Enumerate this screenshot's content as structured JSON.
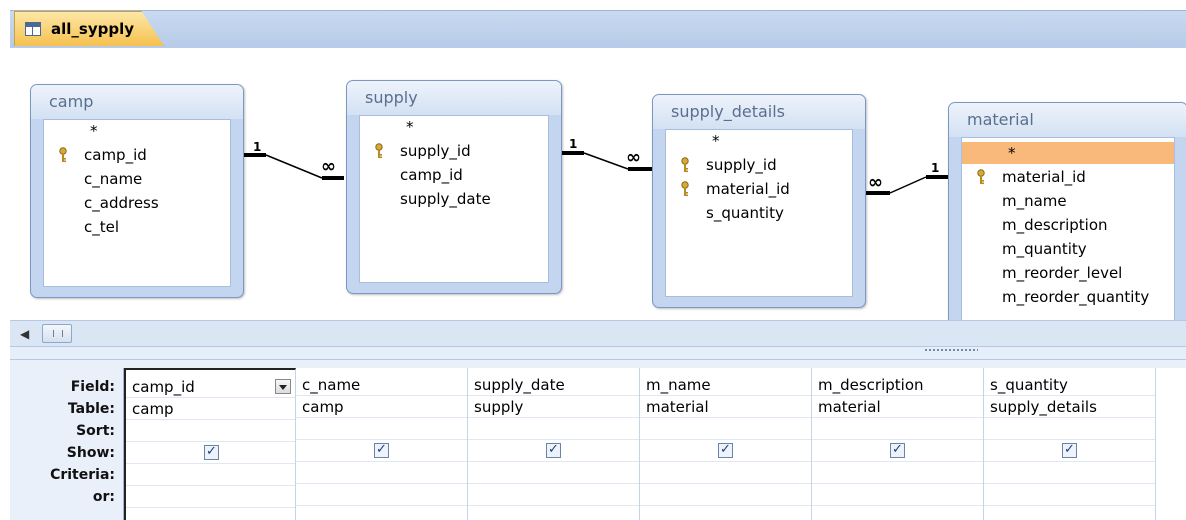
{
  "tab": {
    "title": "all_sypply"
  },
  "tables": [
    {
      "name": "camp",
      "fields": [
        {
          "label": "*",
          "key": false
        },
        {
          "label": "camp_id",
          "key": true
        },
        {
          "label": "c_name",
          "key": false
        },
        {
          "label": "c_address",
          "key": false
        },
        {
          "label": "c_tel",
          "key": false
        }
      ]
    },
    {
      "name": "supply",
      "fields": [
        {
          "label": "*",
          "key": false
        },
        {
          "label": "supply_id",
          "key": true
        },
        {
          "label": "camp_id",
          "key": false
        },
        {
          "label": "supply_date",
          "key": false
        }
      ]
    },
    {
      "name": "supply_details",
      "fields": [
        {
          "label": "*",
          "key": false
        },
        {
          "label": "supply_id",
          "key": true
        },
        {
          "label": "material_id",
          "key": true
        },
        {
          "label": "s_quantity",
          "key": false
        }
      ]
    },
    {
      "name": "material",
      "fields": [
        {
          "label": "*",
          "key": false,
          "selected": true
        },
        {
          "label": "material_id",
          "key": true
        },
        {
          "label": "m_name",
          "key": false
        },
        {
          "label": "m_description",
          "key": false
        },
        {
          "label": "m_quantity",
          "key": false
        },
        {
          "label": "m_reorder_level",
          "key": false
        },
        {
          "label": "m_reorder_quantity",
          "key": false
        }
      ]
    }
  ],
  "relationships": [
    {
      "one": "1",
      "many": "∞"
    },
    {
      "one": "1",
      "many": "∞"
    },
    {
      "one": "1",
      "many": "∞"
    }
  ],
  "grid": {
    "row_labels": [
      "Field:",
      "Table:",
      "Sort:",
      "Show:",
      "Criteria:",
      "or:"
    ],
    "columns": [
      {
        "field": "camp_id",
        "table": "camp",
        "show": true
      },
      {
        "field": "c_name",
        "table": "camp",
        "show": true
      },
      {
        "field": "supply_date",
        "table": "supply",
        "show": true
      },
      {
        "field": "m_name",
        "table": "material",
        "show": true
      },
      {
        "field": "m_description",
        "table": "material",
        "show": true
      },
      {
        "field": "s_quantity",
        "table": "supply_details",
        "show": true
      }
    ]
  },
  "colors": {
    "tab": "#f6c14f",
    "selected_field": "#f9b97a",
    "pane": "#c4d6ef"
  }
}
